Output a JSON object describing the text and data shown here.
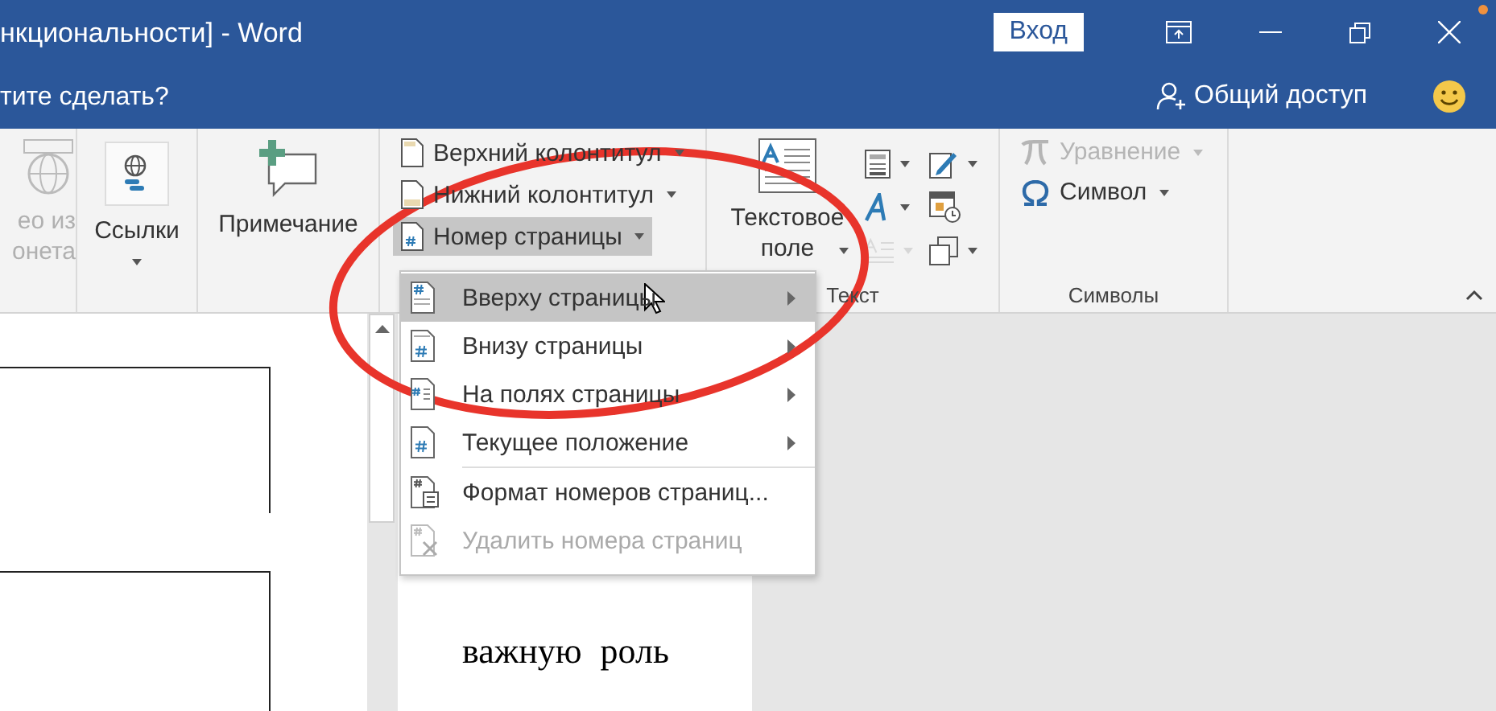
{
  "window": {
    "title": "нкциональности]  -  Word",
    "signin": "Вход",
    "tell_me": "тите сделать?",
    "share": "Общий доступ"
  },
  "ribbon": {
    "online_video": {
      "lines": [
        "ео из",
        "онета"
      ],
      "disabled": true,
      "dropdown": false
    },
    "links": {
      "lines": [
        "Ссылки"
      ],
      "disabled": false,
      "dropdown": true
    },
    "comment": {
      "lines": [
        "Примечание"
      ],
      "disabled": false,
      "dropdown": false
    },
    "header_footer": [
      {
        "kind": "header",
        "label": "Верхний колонтитул",
        "pressed": false
      },
      {
        "kind": "footer",
        "label": "Нижний колонтитул",
        "pressed": false
      },
      {
        "kind": "page-number",
        "label": "Номер страницы",
        "pressed": true
      }
    ],
    "text_box": {
      "lines": [
        "Текстовое",
        "поле"
      ],
      "disabled": false,
      "dropdown": true
    },
    "text_tools": [
      {
        "kind": "quick-parts",
        "dropdown": true,
        "disabled": false
      },
      {
        "kind": "signature",
        "dropdown": true,
        "disabled": false
      },
      {
        "kind": "wordart",
        "dropdown": true,
        "disabled": false
      },
      {
        "kind": "date",
        "dropdown": false,
        "disabled": false
      },
      {
        "kind": "dropcap",
        "dropdown": true,
        "disabled": true
      },
      {
        "kind": "object",
        "dropdown": true,
        "disabled": false
      }
    ],
    "text_label": "Текст",
    "symbols": [
      {
        "kind": "equation",
        "label": "Уравнение",
        "disabled": true
      },
      {
        "kind": "symbol",
        "label": "Символ",
        "disabled": false
      }
    ],
    "symbols_label": "Символы"
  },
  "menu": {
    "items": [
      {
        "kind": "top",
        "label": "Вверху страницы",
        "submenu": true,
        "selected": true,
        "disabled": false,
        "separator_before": false
      },
      {
        "kind": "bottom",
        "label": "Внизу страницы",
        "submenu": true,
        "selected": false,
        "disabled": false,
        "separator_before": false
      },
      {
        "kind": "margin",
        "label": "На полях страницы",
        "submenu": true,
        "selected": false,
        "disabled": false,
        "separator_before": false
      },
      {
        "kind": "current",
        "label": "Текущее положение",
        "submenu": true,
        "selected": false,
        "disabled": false,
        "separator_before": false
      },
      {
        "kind": "format",
        "label": "Формат номеров страниц...",
        "submenu": false,
        "selected": false,
        "disabled": false,
        "separator_before": true
      },
      {
        "kind": "remove",
        "label": "Удалить номера страниц",
        "submenu": false,
        "selected": false,
        "disabled": true,
        "separator_before": false
      }
    ]
  },
  "document": {
    "text": "важную роль"
  }
}
